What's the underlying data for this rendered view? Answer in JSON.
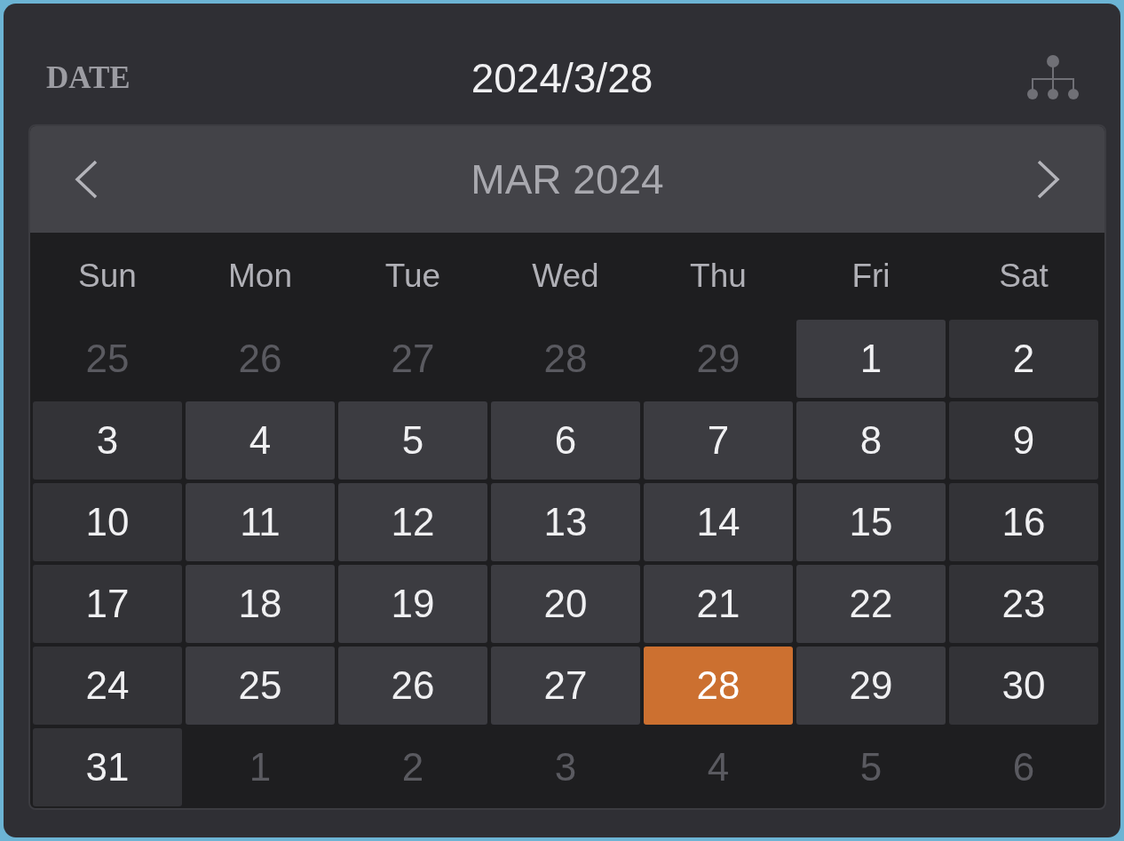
{
  "field": {
    "label": "DATE",
    "value": "2024/3/28"
  },
  "calendar": {
    "month_title": "MAR 2024",
    "weekdays": [
      "Sun",
      "Mon",
      "Tue",
      "Wed",
      "Thu",
      "Fri",
      "Sat"
    ],
    "days": [
      {
        "label": "25",
        "kind": "outside",
        "selected": false
      },
      {
        "label": "26",
        "kind": "outside",
        "selected": false
      },
      {
        "label": "27",
        "kind": "outside",
        "selected": false
      },
      {
        "label": "28",
        "kind": "outside",
        "selected": false
      },
      {
        "label": "29",
        "kind": "outside",
        "selected": false
      },
      {
        "label": "1",
        "kind": "day",
        "selected": false
      },
      {
        "label": "2",
        "kind": "day",
        "selected": false
      },
      {
        "label": "3",
        "kind": "day",
        "selected": false
      },
      {
        "label": "4",
        "kind": "day",
        "selected": false
      },
      {
        "label": "5",
        "kind": "day",
        "selected": false
      },
      {
        "label": "6",
        "kind": "day",
        "selected": false
      },
      {
        "label": "7",
        "kind": "day",
        "selected": false
      },
      {
        "label": "8",
        "kind": "day",
        "selected": false
      },
      {
        "label": "9",
        "kind": "day",
        "selected": false
      },
      {
        "label": "10",
        "kind": "day",
        "selected": false
      },
      {
        "label": "11",
        "kind": "day",
        "selected": false
      },
      {
        "label": "12",
        "kind": "day",
        "selected": false
      },
      {
        "label": "13",
        "kind": "day",
        "selected": false
      },
      {
        "label": "14",
        "kind": "day",
        "selected": false
      },
      {
        "label": "15",
        "kind": "day",
        "selected": false
      },
      {
        "label": "16",
        "kind": "day",
        "selected": false
      },
      {
        "label": "17",
        "kind": "day",
        "selected": false
      },
      {
        "label": "18",
        "kind": "day",
        "selected": false
      },
      {
        "label": "19",
        "kind": "day",
        "selected": false
      },
      {
        "label": "20",
        "kind": "day",
        "selected": false
      },
      {
        "label": "21",
        "kind": "day",
        "selected": false
      },
      {
        "label": "22",
        "kind": "day",
        "selected": false
      },
      {
        "label": "23",
        "kind": "day",
        "selected": false
      },
      {
        "label": "24",
        "kind": "day",
        "selected": false
      },
      {
        "label": "25",
        "kind": "day",
        "selected": false
      },
      {
        "label": "26",
        "kind": "day",
        "selected": false
      },
      {
        "label": "27",
        "kind": "day",
        "selected": false
      },
      {
        "label": "28",
        "kind": "day",
        "selected": true
      },
      {
        "label": "29",
        "kind": "day",
        "selected": false
      },
      {
        "label": "30",
        "kind": "day",
        "selected": false
      },
      {
        "label": "31",
        "kind": "day",
        "selected": false
      },
      {
        "label": "1",
        "kind": "outside",
        "selected": false
      },
      {
        "label": "2",
        "kind": "outside",
        "selected": false
      },
      {
        "label": "3",
        "kind": "outside",
        "selected": false
      },
      {
        "label": "4",
        "kind": "outside",
        "selected": false
      },
      {
        "label": "5",
        "kind": "outside",
        "selected": false
      },
      {
        "label": "6",
        "kind": "outside",
        "selected": false
      }
    ]
  }
}
